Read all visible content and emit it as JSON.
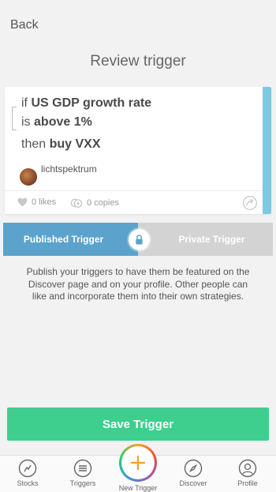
{
  "nav": {
    "back_label": "Back"
  },
  "page": {
    "title": "Review trigger"
  },
  "trigger": {
    "if_kw": "if",
    "metric": "US GDP growth rate",
    "is_kw": "is",
    "condition": "above 1%",
    "then_kw": "then",
    "action": "buy VXX",
    "author": "lichtspektrum",
    "likes": "0 likes",
    "copies": "0 copies"
  },
  "visibility": {
    "published_label": "Published Trigger",
    "private_label": "Private Trigger",
    "selected": "published"
  },
  "description": "Publish your triggers to have them be featured on the Discover page and on your profile. Other people can like and incorporate them into their own strategies.",
  "save_label": "Save Trigger",
  "tabs": [
    {
      "label": "Stocks",
      "icon": "stocks-icon"
    },
    {
      "label": "Triggers",
      "icon": "triggers-icon"
    },
    {
      "label": "New Trigger",
      "icon": "plus-icon"
    },
    {
      "label": "Discover",
      "icon": "compass-icon"
    },
    {
      "label": "Profile",
      "icon": "profile-icon"
    }
  ],
  "colors": {
    "accent_blue": "#5ba3cc",
    "card_accent": "#7ec8e3",
    "save_green": "#3ecf8e",
    "private_gray": "#d3d3d3"
  }
}
